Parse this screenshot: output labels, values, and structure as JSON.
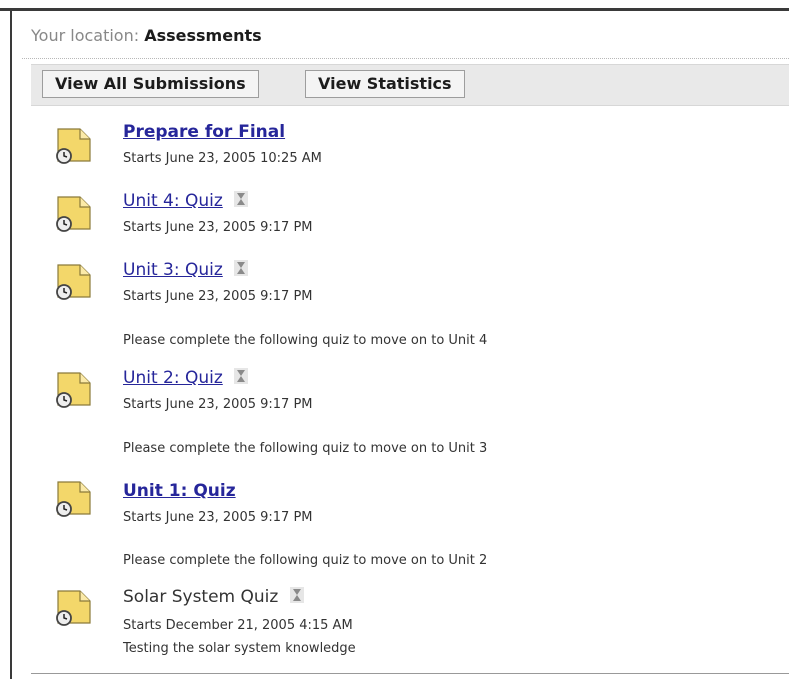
{
  "breadcrumb": {
    "label": "Your location:",
    "location": "Assessments"
  },
  "toolbar": {
    "view_all_submissions": "View All Submissions",
    "view_statistics": "View Statistics"
  },
  "assessments": [
    {
      "title": "Prepare for Final",
      "starts": "Starts June 23, 2005 10:25 AM",
      "style": "bold-link",
      "hourglass_icon": false
    },
    {
      "title": "Unit 4: Quiz",
      "starts": "Starts June 23, 2005 9:17 PM",
      "style": "link",
      "hourglass_icon": true
    },
    {
      "title": "Unit 3: Quiz",
      "starts": "Starts June 23, 2005 9:17 PM",
      "style": "link",
      "hourglass_icon": true,
      "note": "Please complete the following quiz to move on to Unit 4"
    },
    {
      "title": "Unit 2: Quiz",
      "starts": "Starts June 23, 2005 9:17 PM",
      "style": "link",
      "hourglass_icon": true,
      "note": "Please complete the following quiz to move on to Unit 3"
    },
    {
      "title": "Unit 1: Quiz",
      "starts": "Starts June 23, 2005 9:17 PM",
      "style": "bold-link",
      "hourglass_icon": false,
      "note": "Please complete the following quiz to move on to Unit 2"
    },
    {
      "title": "Solar System Quiz",
      "starts": "Starts December 21, 2005 4:15 AM",
      "style": "plain",
      "hourglass_icon": true,
      "description": "Testing the solar system knowledge"
    }
  ],
  "colors": {
    "link": "#26269a",
    "toolbar_bg": "#e9e9e9",
    "icon_yellow": "#f3d76a",
    "text": "#333333"
  },
  "icons": {
    "assessment": "assessment-file-icon",
    "availability": "hourglass-icon"
  }
}
